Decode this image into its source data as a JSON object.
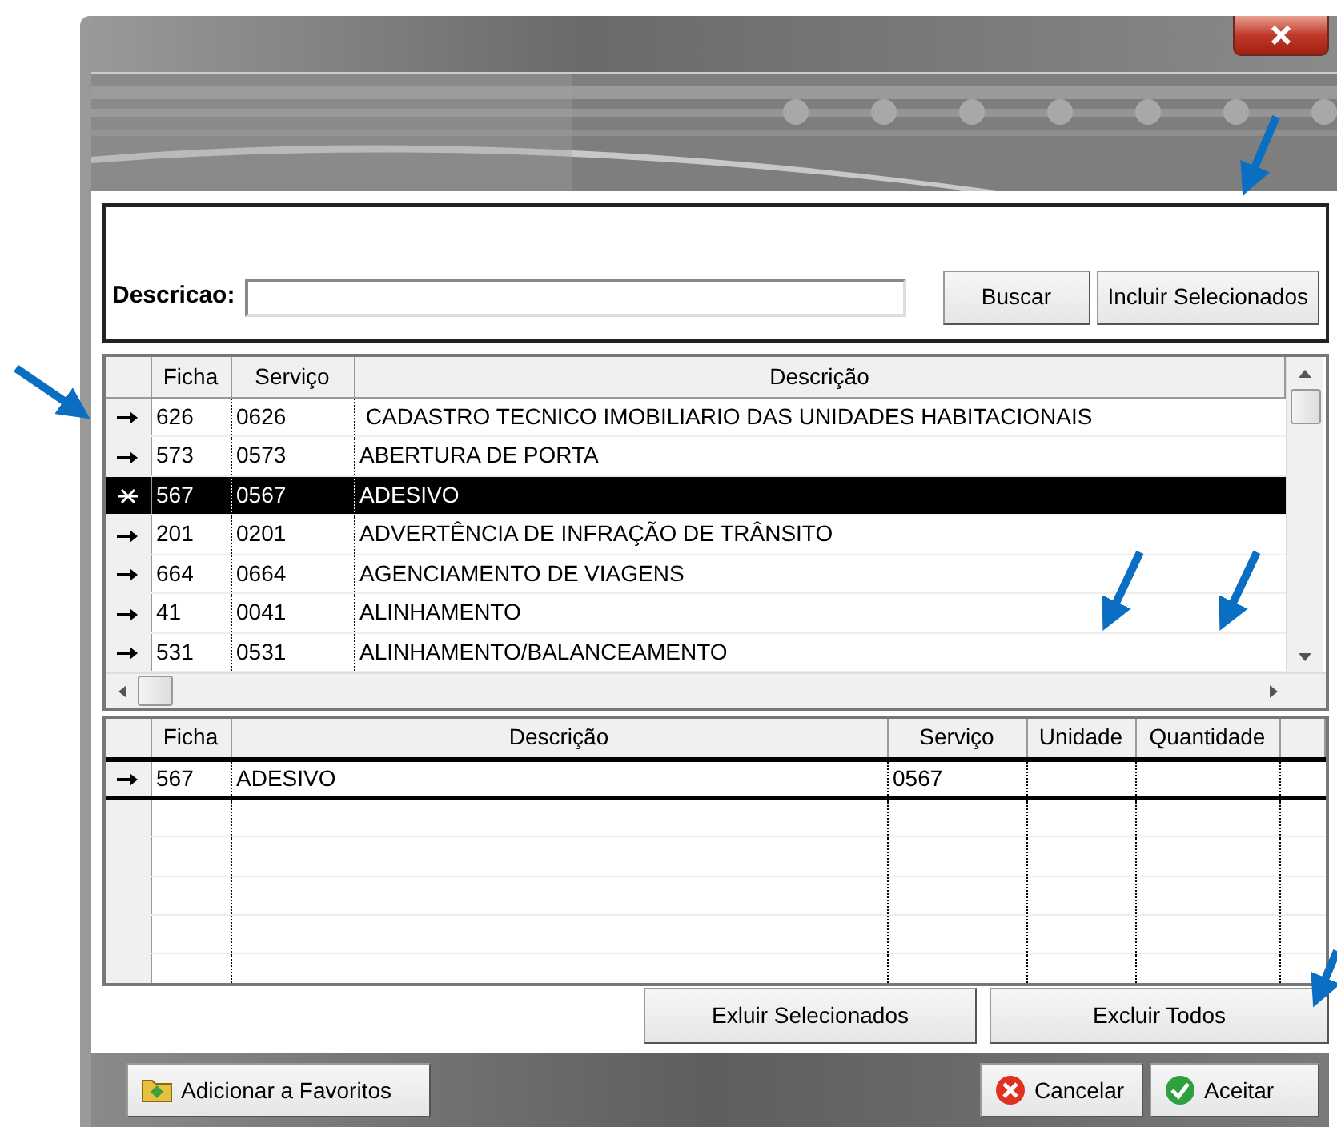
{
  "search": {
    "label": "Descricao:",
    "buttons": [
      "Buscar",
      "Incluir Selecionados"
    ]
  },
  "services_table": {
    "columns": [
      "Ficha",
      "Serviço",
      "Descrição"
    ],
    "rows": [
      {
        "ficha": "626",
        "servico": "0626",
        "descricao": " CADASTRO TECNICO IMOBILIARIO DAS UNIDADES HABITACIONAIS",
        "selected": false
      },
      {
        "ficha": "573",
        "servico": "0573",
        "descricao": "ABERTURA DE PORTA",
        "selected": false
      },
      {
        "ficha": "567",
        "servico": "0567",
        "descricao": "ADESIVO",
        "selected": true
      },
      {
        "ficha": "201",
        "servico": "0201",
        "descricao": "ADVERTÊNCIA DE INFRAÇÃO DE TRÂNSITO",
        "selected": false
      },
      {
        "ficha": "664",
        "servico": "0664",
        "descricao": "AGENCIAMENTO DE VIAGENS",
        "selected": false
      },
      {
        "ficha": "41",
        "servico": "0041",
        "descricao": "ALINHAMENTO",
        "selected": false
      },
      {
        "ficha": "531",
        "servico": "0531",
        "descricao": "ALINHAMENTO/BALANCEAMENTO",
        "selected": false
      }
    ]
  },
  "selected_table": {
    "columns": [
      "Ficha",
      "Descrição",
      "Serviço",
      "Unidade",
      "Quantidade"
    ],
    "rows": [
      {
        "ficha": "567",
        "descricao": "ADESIVO",
        "servico": "0567",
        "selected": true
      }
    ]
  },
  "table_buttons": [
    "Exluir Selecionados",
    "Excluir Todos"
  ],
  "footer_buttons": [
    {
      "kind": "favorite",
      "label": "Adicionar a Favoritos"
    },
    {
      "kind": "cancel",
      "label": "Cancelar"
    },
    {
      "kind": "accept",
      "label": "Aceitar"
    }
  ]
}
